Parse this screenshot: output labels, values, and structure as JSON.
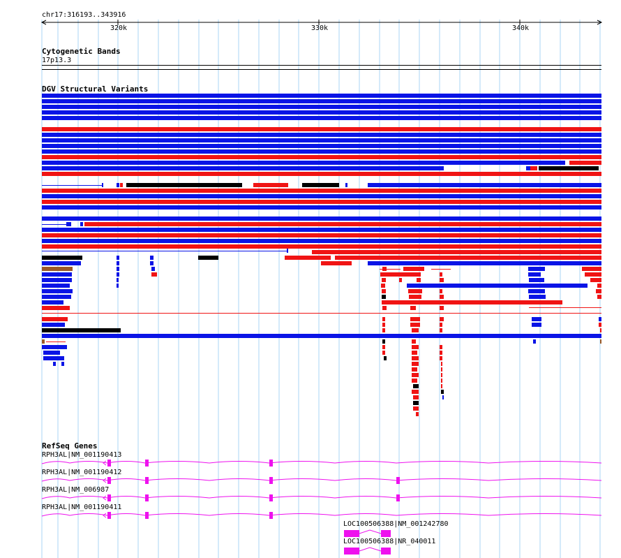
{
  "location": {
    "region_label": "chr17:316193..343916"
  },
  "ruler": {
    "ticks": [
      "320k",
      "330k",
      "340k"
    ]
  },
  "tracks": {
    "cytoband": {
      "title": "Cytogenetic Bands",
      "band_label": "17p13.3"
    },
    "dgv": {
      "title": "DGV Structural Variants"
    },
    "refseq": {
      "title": "RefSeq Genes",
      "transcripts": [
        "RPH3AL|NM_001190413",
        "RPH3AL|NM_001190412",
        "RPH3AL|NM_006987",
        "RPH3AL|NM_001190411",
        "LOC100506388|NM_001242780",
        "LOC100506388|NR_040011"
      ]
    }
  },
  "colors": {
    "gain": "#0a14e6",
    "loss": "#f01414",
    "other": "#000000",
    "complex": "#9b5a28",
    "gene": "#ee11ee",
    "grid": "#a8d4f4"
  }
}
